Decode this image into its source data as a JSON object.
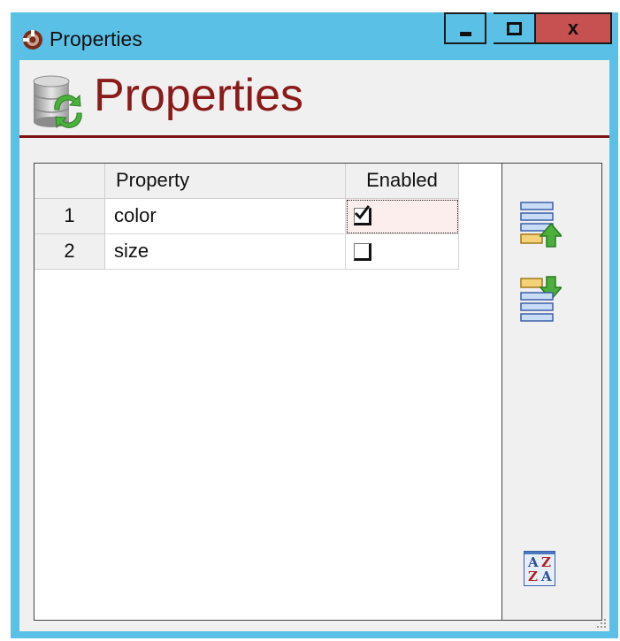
{
  "window": {
    "title": "Properties"
  },
  "header": {
    "title": "Properties"
  },
  "controls": {
    "close_glyph": "x"
  },
  "grid": {
    "columns": [
      "Property",
      "Enabled"
    ],
    "rows": [
      {
        "num": "1",
        "property": "color",
        "enabled": true
      },
      {
        "num": "2",
        "property": "size",
        "enabled": false
      }
    ]
  },
  "side_buttons": {
    "sort_icon_text": [
      "A",
      "Z",
      "Z",
      "A"
    ]
  },
  "colors": {
    "titlebar": "#5bc0e6",
    "header_title": "#8b1a1a",
    "close_button": "#c75050"
  }
}
